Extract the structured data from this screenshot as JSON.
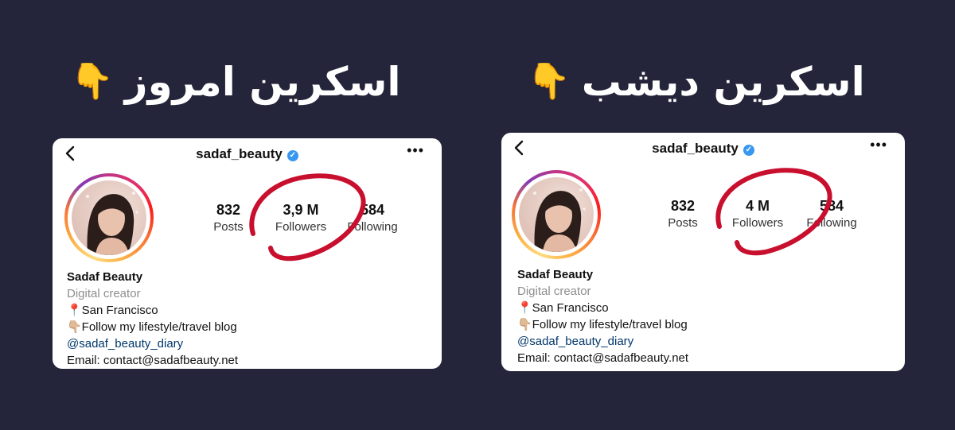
{
  "headings": {
    "left": "اسکرین امروز",
    "right": "اسکرین دیشب",
    "pointer_emoji": "👇"
  },
  "cards": [
    {
      "username": "sadaf_beauty",
      "posts_count": "832",
      "posts_label": "Posts",
      "followers_count": "3,9 M",
      "followers_label": "Followers",
      "following_count": "584",
      "following_label": "Following",
      "name": "Sadaf Beauty",
      "category": "Digital creator",
      "location": "📍San Francisco",
      "bio_line": "👇🏼Follow my lifestyle/travel blog",
      "mention": "@sadaf_beauty_diary",
      "email": "Email: contact@sadafbeauty.net"
    },
    {
      "username": "sadaf_beauty",
      "posts_count": "832",
      "posts_label": "Posts",
      "followers_count": "4 M",
      "followers_label": "Followers",
      "following_count": "584",
      "following_label": "Following",
      "name": "Sadaf Beauty",
      "category": "Digital creator",
      "location": "📍San Francisco",
      "bio_line": "👇🏼Follow my lifestyle/travel blog",
      "mention": "@sadaf_beauty_diary",
      "email": "Email: contact@sadafbeauty.net"
    }
  ],
  "icons": {
    "back": "chevron-left-icon",
    "more": "more-horizontal-icon",
    "verified": "verified-badge-icon"
  },
  "colors": {
    "background": "#24243a",
    "circle_mark": "#c8102e",
    "verified": "#3897f0",
    "link": "#00376b"
  }
}
